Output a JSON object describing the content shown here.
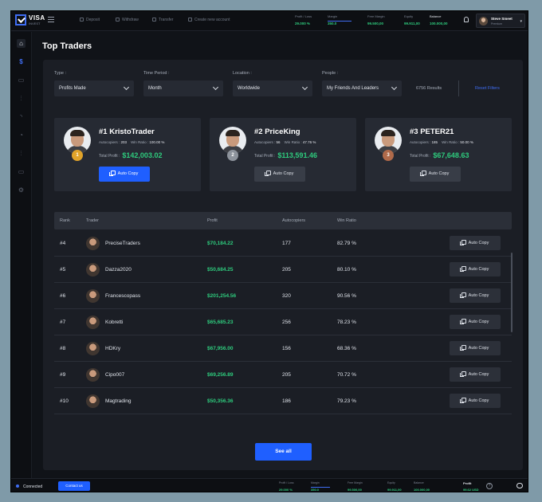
{
  "app": {
    "logo_text": "VISA",
    "logo_sub": "INVEST"
  },
  "topnav": [
    {
      "label": "Deposit",
      "icon": "deposit-icon"
    },
    {
      "label": "Withdraw",
      "icon": "withdraw-icon"
    },
    {
      "label": "Transfer",
      "icon": "transfer-icon"
    },
    {
      "label": "Create new account",
      "icon": "add-account-icon"
    }
  ],
  "top_stats": [
    {
      "label": "Profit / Loss",
      "value": "29.000 %"
    },
    {
      "label": "Margin",
      "value": "350.0"
    },
    {
      "label": "Free Margin",
      "value": "99.500,00"
    },
    {
      "label": "Equity",
      "value": "99.911,00"
    },
    {
      "label": "Balance",
      "value": "100.000,00"
    }
  ],
  "user": {
    "name": "Steve Smeet",
    "role": "Premium"
  },
  "page": {
    "title": "Top Traders"
  },
  "filters": {
    "type": {
      "label": "Type :",
      "value": "Profits Made"
    },
    "period": {
      "label": "Time Period :",
      "value": "Month"
    },
    "location": {
      "label": "Location :",
      "value": "Worldwide"
    },
    "people": {
      "label": "People :",
      "value": "My Friends And Leaders"
    },
    "results": "6756 Results",
    "reset": "Reset Filters"
  },
  "top3": [
    {
      "rank_title": "#1 KristoTrader",
      "medal": "1",
      "medal_color": "#e0a32a",
      "autocopiers_label": "Autocopiers :",
      "autocopiers": "203",
      "winratio_label": "Win Ratio :",
      "winratio": "100.00 %",
      "profit_label": "Total Profit :",
      "profit": "$142,003.02",
      "button": "Auto Copy"
    },
    {
      "rank_title": "#2 PriceKing",
      "medal": "2",
      "medal_color": "#8d939c",
      "autocopiers_label": "Autocopiers :",
      "autocopiers": "56",
      "winratio_label": "Win Ratio :",
      "winratio": "47.76 %",
      "profit_label": "Total Profit :",
      "profit": "$113,591.46",
      "button": "Auto Copy"
    },
    {
      "rank_title": "#3 PETER21",
      "medal": "3",
      "medal_color": "#b06a4a",
      "autocopiers_label": "Autocopiers :",
      "autocopiers": "185",
      "winratio_label": "Win Ratio :",
      "winratio": "50.00 %",
      "profit_label": "Total Profit :",
      "profit": "$67,648.63",
      "button": "Auto Copy"
    }
  ],
  "table": {
    "headers": [
      "Rank",
      "Trader",
      "Profit",
      "Autocopiers",
      "Win Ratio"
    ],
    "rows": [
      {
        "rank": "#4",
        "trader": "PreciseTraders",
        "profit": "$70,184.22",
        "autocopiers": "177",
        "winratio": "82.79 %",
        "button": "Auto Copy"
      },
      {
        "rank": "#5",
        "trader": "Dazza2020",
        "profit": "$50,684.25",
        "autocopiers": "205",
        "winratio": "80.10 %",
        "button": "Auto Copy"
      },
      {
        "rank": "#6",
        "trader": "Francescopass",
        "profit": "$201,254.56",
        "autocopiers": "320",
        "winratio": "90.56 %",
        "button": "Auto Copy"
      },
      {
        "rank": "#7",
        "trader": "Kobretti",
        "profit": "$65,685.23",
        "autocopiers": "256",
        "winratio": "78.23 %",
        "button": "Auto Copy"
      },
      {
        "rank": "#8",
        "trader": "HDKry",
        "profit": "$67,956.00",
        "autocopiers": "156",
        "winratio": "68.36 %",
        "button": "Auto Copy"
      },
      {
        "rank": "#9",
        "trader": "Cipo007",
        "profit": "$69,256.89",
        "autocopiers": "205",
        "winratio": "70.72 %",
        "button": "Auto Copy"
      },
      {
        "rank": "#10",
        "trader": "Magtrading",
        "profit": "$50,356.36",
        "autocopiers": "186",
        "winratio": "79.23 %",
        "button": "Auto Copy"
      }
    ],
    "see_all": "See all"
  },
  "footer": {
    "status": "Connected",
    "contact": "Contact us",
    "stats": [
      {
        "label": "Profit / Loss",
        "value": "29.000 %"
      },
      {
        "label": "Margin",
        "value": "350.0"
      },
      {
        "label": "Free Margin",
        "value": "99.500,00"
      },
      {
        "label": "Equity",
        "value": "99.911,00"
      },
      {
        "label": "Balance",
        "value": "100.000,00"
      }
    ],
    "profit_label": "Profit",
    "profit_value": "99.62 USD"
  },
  "colors": {
    "accent": "#1f5fff",
    "positive": "#2ecb7d",
    "background": "#101318",
    "panel": "#1b1e25"
  }
}
